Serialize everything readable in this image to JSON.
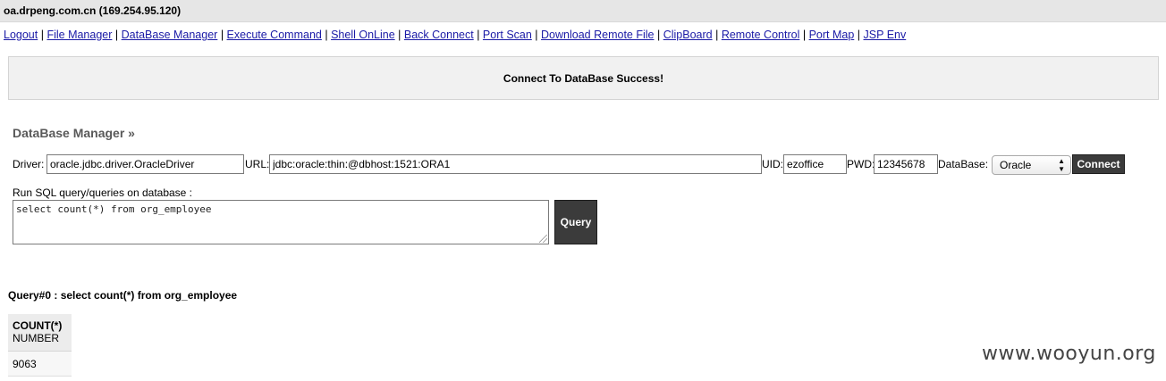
{
  "window": {
    "host_title": "oa.drpeng.com.cn (169.254.95.120)"
  },
  "nav": [
    {
      "label": "Logout"
    },
    {
      "label": "File Manager"
    },
    {
      "label": "DataBase Manager"
    },
    {
      "label": "Execute Command"
    },
    {
      "label": "Shell OnLine"
    },
    {
      "label": "Back Connect"
    },
    {
      "label": "Port Scan"
    },
    {
      "label": "Download Remote File"
    },
    {
      "label": "ClipBoard"
    },
    {
      "label": "Remote Control"
    },
    {
      "label": "Port Map"
    },
    {
      "label": "JSP Env"
    }
  ],
  "nav_separator": "|",
  "notice": "Connect To DataBase Success!",
  "section_title": "DataBase Manager »",
  "connection": {
    "driver_label": "Driver:",
    "driver_value": "oracle.jdbc.driver.OracleDriver",
    "url_label": "URL:",
    "url_value": "jdbc:oracle:thin:@dbhost:1521:ORA1",
    "uid_label": "UID:",
    "uid_value": "ezoffice",
    "pwd_label": "PWD:",
    "pwd_value": "12345678",
    "database_label": "DataBase:",
    "database_selected": "Oracle",
    "connect_label": "Connect"
  },
  "sql": {
    "label": "Run SQL query/queries on database :",
    "text": "select count(*) from org_employee",
    "query_button": "Query"
  },
  "result": {
    "title": "Query#0 : select count(*) from org_employee",
    "column_name": "COUNT(*)",
    "column_type": "NUMBER",
    "rows": [
      "9063"
    ]
  },
  "watermark": "www.wooyun.org",
  "colors": {
    "link": "#1a1aa6",
    "button_bg": "#3b3b3b",
    "topbar_bg": "#e6e6e6",
    "notice_bg": "#f1f1f1"
  }
}
